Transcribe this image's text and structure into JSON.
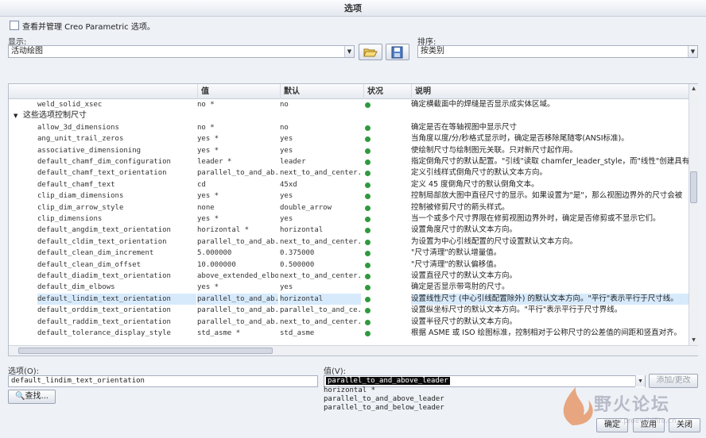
{
  "window": {
    "title": "选项"
  },
  "manage": {
    "label": "查看并管理 Creo Parametric 选项。"
  },
  "display": {
    "label": "显示:",
    "value": "活动绘图"
  },
  "sort": {
    "label": "排序:",
    "value": "按类别"
  },
  "columns": {
    "name": "",
    "value": "值",
    "default": "默认",
    "status": "状况",
    "description": "说明"
  },
  "rows": [
    {
      "name": "weld_solid_xsec",
      "value": "no *",
      "default": "no",
      "desc": "确定横截面中的焊缝是否显示成实体区域。"
    },
    {
      "group": "这些选项控制尺寸"
    },
    {
      "name": "allow_3d_dimensions",
      "value": "no *",
      "default": "no",
      "desc": "确定是否在等轴视图中显示尺寸"
    },
    {
      "name": "ang_unit_trail_zeros",
      "value": "yes *",
      "default": "yes",
      "desc": "当角度以度/分/秒格式显示时，确定是否移除尾随零(ANSI标准)。"
    },
    {
      "name": "associative_dimensioning",
      "value": "yes *",
      "default": "yes",
      "desc": "使绘制尺寸与绘制图元关联。只对新尺寸起作用。"
    },
    {
      "name": "default_chamf_dim_configuration",
      "value": "leader *",
      "default": "leader",
      "desc": "指定倒角尺寸的默认配置。\"引线\"读取 chamfer_leader_style，而\"线性\"创建具有"
    },
    {
      "name": "default_chamf_text_orientation",
      "value": "parallel_to_and_ab...",
      "default": "next_to_and_center...",
      "desc": "定义引线样式倒角尺寸的默认文本方向。"
    },
    {
      "name": "default_chamf_text",
      "value": "cd",
      "default": "45xd",
      "desc": "定义 45 度倒角尺寸的默认倒角文本。"
    },
    {
      "name": "clip_diam_dimensions",
      "value": "yes *",
      "default": "yes",
      "desc": "控制局部放大图中直径尺寸的显示。如果设置为\"是\"，那么视图边界外的尺寸会被"
    },
    {
      "name": "clip_dim_arrow_style",
      "value": "none",
      "default": "double_arrow",
      "desc": "控制被修剪尺寸的箭头样式。"
    },
    {
      "name": "clip_dimensions",
      "value": "yes *",
      "default": "yes",
      "desc": "当一个或多个尺寸界限在修剪视图边界外时，确定是否修剪或不显示它们。"
    },
    {
      "name": "default_angdim_text_orientation",
      "value": "horizontal *",
      "default": "horizontal",
      "desc": "设置角度尺寸的默认文本方向。"
    },
    {
      "name": "default_cldim_text_orientation",
      "value": "parallel_to_and_ab...",
      "default": "next_to_and_center...",
      "desc": "为设置为中心引线配置的尺寸设置默认文本方向。"
    },
    {
      "name": "default_clean_dim_increment",
      "value": "5.000000",
      "default": "0.375000",
      "desc": "\"尺寸清理\"的默认增量值。"
    },
    {
      "name": "default_clean_dim_offset",
      "value": "10.000000",
      "default": "0.500000",
      "desc": "\"尺寸清理\"的默认偏移值。"
    },
    {
      "name": "default_diadim_text_orientation",
      "value": "above_extended_elbow",
      "default": "next_to_and_center...",
      "desc": "设置直径尺寸的默认文本方向。"
    },
    {
      "name": "default_dim_elbows",
      "value": "yes *",
      "default": "yes",
      "desc": "确定是否显示带弯肘的尺寸。"
    },
    {
      "name": "default_lindim_text_orientation",
      "value": "parallel_to_and_ab...",
      "default": "horizontal",
      "desc": "设置线性尺寸 (中心引线配置除外) 的默认文本方向。\"平行\"表示平行于尺寸线。",
      "selected": true
    },
    {
      "name": "default_orddim_text_orientation",
      "value": "parallel_to_and_ab...",
      "default": "parallel_to_and_ce...",
      "desc": "设置纵坐标尺寸的默认文本方向。\"平行\"表示平行于尺寸界线。"
    },
    {
      "name": "default_raddim_text_orientation",
      "value": "parallel_to_and_ab...",
      "default": "next_to_and_center...",
      "desc": "设置半径尺寸的默认文本方向。"
    },
    {
      "name": "default_tolerance_display_style",
      "value": "std_asme *",
      "default": "std_asme",
      "desc": "根据 ASME 或 ISO 绘图标准，控制相对于公称尺寸的公差值的间距和竖直对齐。"
    }
  ],
  "option": {
    "label": "选项(O):",
    "value": "default_lindim_text_orientation",
    "find": "查找..."
  },
  "value_field": {
    "label": "值(V):",
    "value": "parallel_to_and_above_leader",
    "add": "添加/更改"
  },
  "value_options": [
    "horizontal *",
    "parallel_to_and_above_leader",
    "parallel_to_and_below_leader"
  ],
  "footer": {
    "ok": "确定",
    "apply": "应用",
    "close": "关闭"
  },
  "watermark": {
    "text": "野火论坛",
    "url": "www.proewildfire.cn"
  }
}
